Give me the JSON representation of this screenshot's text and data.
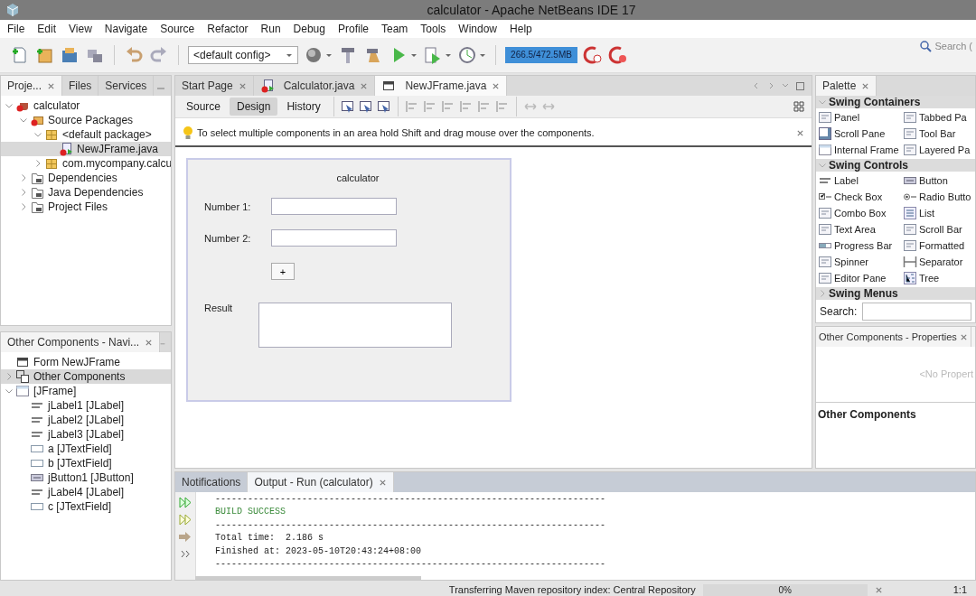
{
  "window": {
    "title": "calculator - Apache NetBeans IDE 17"
  },
  "menu": [
    "File",
    "Edit",
    "View",
    "Navigate",
    "Source",
    "Refactor",
    "Run",
    "Debug",
    "Profile",
    "Team",
    "Tools",
    "Window",
    "Help"
  ],
  "toolbar": {
    "config": "<default config>",
    "memory": {
      "reading": "266.5/472.5MB",
      "level": 1
    }
  },
  "search": {
    "placeholder": "Search ("
  },
  "projects_panel": {
    "tabs": [
      {
        "label": "Proje...",
        "selected": true
      },
      {
        "label": "Files",
        "selected": false
      },
      {
        "label": "Services",
        "selected": false
      }
    ],
    "tree": [
      {
        "label": "calculator",
        "kind": "project",
        "expanded": true,
        "selected": false,
        "children": [
          {
            "label": "Source Packages",
            "kind": "source-folder",
            "expanded": true,
            "selected": false,
            "children": [
              {
                "label": "<default package>",
                "kind": "package",
                "expanded": true,
                "selected": false,
                "children": [
                  {
                    "label": "NewJFrame.java",
                    "kind": "java-file",
                    "selected": true
                  }
                ]
              },
              {
                "label": "com.mycompany.calcu",
                "kind": "package",
                "expanded": false,
                "selected": false
              }
            ]
          },
          {
            "label": "Dependencies",
            "kind": "library",
            "expanded": false,
            "selected": false
          },
          {
            "label": "Java Dependencies",
            "kind": "library",
            "expanded": false,
            "selected": false
          },
          {
            "label": "Project Files",
            "kind": "library",
            "expanded": false,
            "selected": false
          }
        ]
      }
    ]
  },
  "navigator": {
    "title": "Other Components - Navi...",
    "tree": [
      {
        "label": "Form NewJFrame",
        "kind": "form",
        "selected": false
      },
      {
        "label": "Other Components",
        "kind": "components",
        "expanded": false,
        "selected": true
      },
      {
        "label": "[JFrame]",
        "kind": "frame",
        "expanded": true,
        "selected": false,
        "children": [
          {
            "label": "jLabel1 [JLabel]",
            "kind": "label",
            "selected": false
          },
          {
            "label": "jLabel2 [JLabel]",
            "kind": "label",
            "selected": false
          },
          {
            "label": "jLabel3 [JLabel]",
            "kind": "label",
            "selected": false
          },
          {
            "label": "a [JTextField]",
            "kind": "text-field",
            "selected": false
          },
          {
            "label": "b [JTextField]",
            "kind": "text-field",
            "selected": false
          },
          {
            "label": "jButton1 [JButton]",
            "kind": "button",
            "selected": false
          },
          {
            "label": "jLabel4 [JLabel]",
            "kind": "label",
            "selected": false
          },
          {
            "label": "c [JTextField]",
            "kind": "text-field",
            "selected": false
          }
        ]
      }
    ]
  },
  "editor_tabs": [
    {
      "label": "Start Page",
      "selected": false
    },
    {
      "label": "Calculator.java",
      "selected": false
    },
    {
      "label": "NewJFrame.java",
      "selected": true
    }
  ],
  "views": [
    {
      "label": "Source",
      "selected": false
    },
    {
      "label": "Design",
      "selected": true
    },
    {
      "label": "History",
      "selected": false
    }
  ],
  "hint": "To select multiple components in an area hold Shift and drag mouse over the components.",
  "form": {
    "title": "calculator",
    "fields": [
      {
        "label": "Number 1:"
      },
      {
        "label": "Number 2:"
      }
    ],
    "button": "+",
    "result_label": "Result"
  },
  "palette": {
    "title": "Palette",
    "categories": [
      {
        "name": "Swing Containers",
        "expanded": true,
        "items": [
          {
            "label": "Panel",
            "kind": "panel"
          },
          {
            "label": "Tabbed Pa",
            "kind": "tabbed-pane"
          },
          {
            "label": "Scroll Pane",
            "kind": "scroll-pane"
          },
          {
            "label": "Tool Bar",
            "kind": "tool-bar"
          },
          {
            "label": "Internal Frame",
            "kind": "internal-frame"
          },
          {
            "label": "Layered Pa",
            "kind": "layered-pane"
          }
        ]
      },
      {
        "name": "Swing Controls",
        "expanded": true,
        "items": [
          {
            "label": "Label",
            "kind": "label"
          },
          {
            "label": "Button",
            "kind": "button"
          },
          {
            "label": "Check Box",
            "kind": "check-box"
          },
          {
            "label": "Radio Butto",
            "kind": "radio-button"
          },
          {
            "label": "Combo Box",
            "kind": "combo-box"
          },
          {
            "label": "List",
            "kind": "list"
          },
          {
            "label": "Text Area",
            "kind": "text-area"
          },
          {
            "label": "Scroll Bar",
            "kind": "scroll-bar"
          },
          {
            "label": "Progress Bar",
            "kind": "progress-bar"
          },
          {
            "label": "Formatted",
            "kind": "formatted-field"
          },
          {
            "label": "Spinner",
            "kind": "spinner"
          },
          {
            "label": "Separator",
            "kind": "separator"
          },
          {
            "label": "Editor Pane",
            "kind": "editor-pane"
          },
          {
            "label": "Tree",
            "kind": "tree"
          }
        ]
      },
      {
        "name": "Swing Menus",
        "expanded": false
      }
    ],
    "search_label": "Search:"
  },
  "properties": {
    "title": "Other Components - Properties",
    "message": "<No Propert",
    "heading": "Other Components"
  },
  "output": {
    "tabs": [
      {
        "label": "Notifications",
        "selected": false
      },
      {
        "label": "Output - Run (calculator)",
        "selected": true
      }
    ],
    "lines": [
      {
        "kind": "rule",
        "text": "------------------------------------------------------------------------"
      },
      {
        "kind": "success",
        "text": "BUILD SUCCESS"
      },
      {
        "kind": "rule",
        "text": "------------------------------------------------------------------------"
      },
      {
        "kind": "text",
        "text": "Total time:  2.186 s"
      },
      {
        "kind": "text",
        "text": "Finished at: 2023-05-10T20:43:24+08:00"
      },
      {
        "kind": "rule",
        "text": "------------------------------------------------------------------------"
      }
    ]
  },
  "status_bar": {
    "message": "Transferring Maven repository index: Central Repository",
    "progress": {
      "reading": "0%",
      "level": 0
    },
    "position": "1:1"
  }
}
